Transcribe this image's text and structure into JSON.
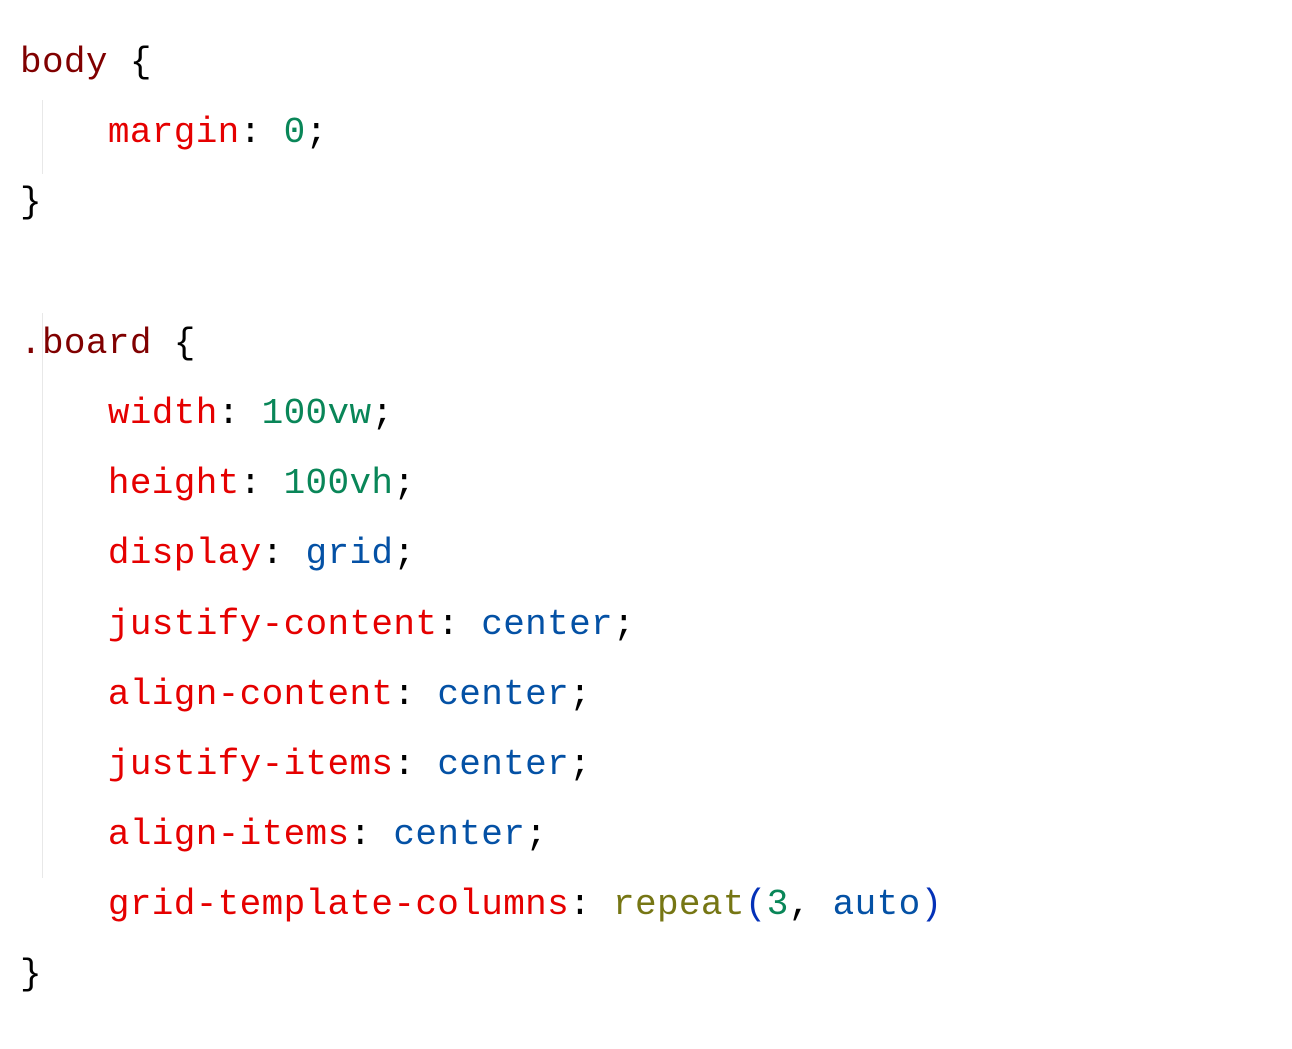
{
  "code": {
    "rule1": {
      "selector": "body",
      "open_brace": " {",
      "decl1_prop": "margin",
      "decl1_colon": ":",
      "decl1_val": " 0",
      "decl1_semi": ";",
      "close_brace": "}"
    },
    "rule2": {
      "selector": ".board",
      "open_brace": " {",
      "decl1_prop": "width",
      "decl1_colon": ":",
      "decl1_val": " 100vw",
      "decl1_semi": ";",
      "decl2_prop": "height",
      "decl2_colon": ":",
      "decl2_val": " 100vh",
      "decl2_semi": ";",
      "decl3_prop": "display",
      "decl3_colon": ":",
      "decl3_val": " grid",
      "decl3_semi": ";",
      "decl4_prop": "justify-content",
      "decl4_colon": ":",
      "decl4_val": " center",
      "decl4_semi": ";",
      "decl5_prop": "align-content",
      "decl5_colon": ":",
      "decl5_val": " center",
      "decl5_semi": ";",
      "decl6_prop": "justify-items",
      "decl6_colon": ":",
      "decl6_val": " center",
      "decl6_semi": ";",
      "decl7_prop": "align-items",
      "decl7_colon": ":",
      "decl7_val": " center",
      "decl7_semi": ";",
      "decl8_prop": "grid-template-columns",
      "decl8_colon": ":",
      "decl8_func": " repeat",
      "decl8_paren_open": "(",
      "decl8_arg1": "3",
      "decl8_comma": ",",
      "decl8_arg2": " auto",
      "decl8_paren_close": ")",
      "close_brace": "}"
    },
    "indent": "    "
  }
}
